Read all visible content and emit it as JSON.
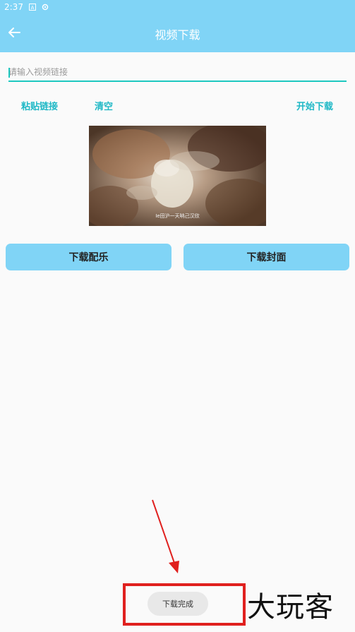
{
  "status_bar": {
    "time": "2:37",
    "icons": [
      "a-icon",
      "settings-gear-icon"
    ]
  },
  "app_bar": {
    "title": "视频下载",
    "back_icon": "arrow-left-icon"
  },
  "url_input": {
    "placeholder": "请输入视频链接",
    "value": ""
  },
  "text_buttons": {
    "paste": "粘贴链接",
    "clear": "清空",
    "start": "开始下载"
  },
  "video": {
    "caption": "Ie田沪一天呐己汉欣"
  },
  "action_buttons": {
    "music": "下载配乐",
    "cover": "下载封面"
  },
  "toast": {
    "text": "下载完成"
  },
  "watermark": {
    "text": "大玩客"
  },
  "colors": {
    "accent": "#80d4f6",
    "link": "#1fb8c6",
    "highlight": "#e0201e"
  }
}
